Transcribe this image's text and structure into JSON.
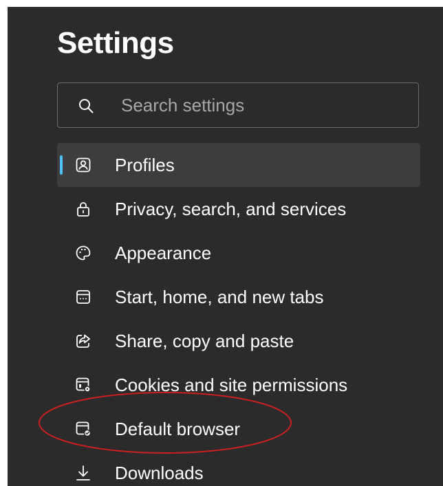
{
  "title": "Settings",
  "search": {
    "placeholder": "Search settings",
    "icon": "search-icon"
  },
  "nav": {
    "active": "Profiles",
    "items": [
      {
        "label": "Profiles",
        "icon": "profile-icon"
      },
      {
        "label": "Privacy, search, and services",
        "icon": "lock-icon"
      },
      {
        "label": "Appearance",
        "icon": "palette-icon"
      },
      {
        "label": "Start, home, and new tabs",
        "icon": "home-tab-icon"
      },
      {
        "label": "Share, copy and paste",
        "icon": "share-icon"
      },
      {
        "label": "Cookies and site permissions",
        "icon": "cookies-permissions-icon"
      },
      {
        "label": "Default browser",
        "icon": "default-browser-icon"
      },
      {
        "label": "Downloads",
        "icon": "download-icon"
      }
    ]
  },
  "colors": {
    "panel_background": "#2b2b2b",
    "active_item_background": "#3d3d3d",
    "active_indicator": "#4cc2ff",
    "annotation_ellipse": "#cc1f1f"
  }
}
